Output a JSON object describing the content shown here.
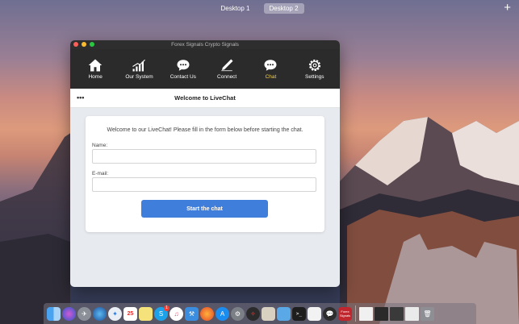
{
  "spaces": {
    "tabs": [
      {
        "label": "Desktop 1",
        "active": false
      },
      {
        "label": "Desktop 2",
        "active": true
      }
    ],
    "add_label": "+"
  },
  "window": {
    "title": "Forex Signals Crypto Signals"
  },
  "navbar": {
    "items": [
      {
        "label": "Home",
        "icon": "home-icon",
        "active": false
      },
      {
        "label": "Our System",
        "icon": "bar-chart-icon",
        "active": false
      },
      {
        "label": "Contact Us",
        "icon": "chat-bubble-icon",
        "active": false
      },
      {
        "label": "Connect",
        "icon": "pen-icon",
        "active": false
      },
      {
        "label": "Chat",
        "icon": "chat-bubble-icon",
        "active": true
      },
      {
        "label": "Settings",
        "icon": "gear-icon",
        "active": false
      }
    ],
    "active_color": "#f7cf3d"
  },
  "chat": {
    "menu_label": "•••",
    "title": "Welcome to LiveChat",
    "welcome": "Welcome to our LiveChat! Please fill in the form below before starting the chat.",
    "name_label": "Name:",
    "name_value": "",
    "email_label": "E-mail:",
    "email_value": "",
    "start_button": "Start the chat",
    "button_color": "#3f7fdb"
  },
  "dock": {
    "calendar_day": "25",
    "skype_badge": "1",
    "icons": [
      "finder-icon",
      "siri-icon",
      "launchpad-icon",
      "network-icon",
      "safari-icon",
      "calendar-icon",
      "notes-icon",
      "skype-icon",
      "music-icon",
      "xcode-icon",
      "firefox-icon",
      "app-store-icon",
      "system-preferences-icon",
      "compass-icon",
      "preview-icon",
      "folder-icon",
      "terminal-icon",
      "text-editor-icon",
      "chat-app-icon",
      "forex-signals-icon",
      "window-thumbnail-icon",
      "window-thumbnail-icon",
      "window-thumbnail-icon",
      "window-thumbnail-icon",
      "trash-icon"
    ],
    "forex_label": "Forex Signals"
  }
}
